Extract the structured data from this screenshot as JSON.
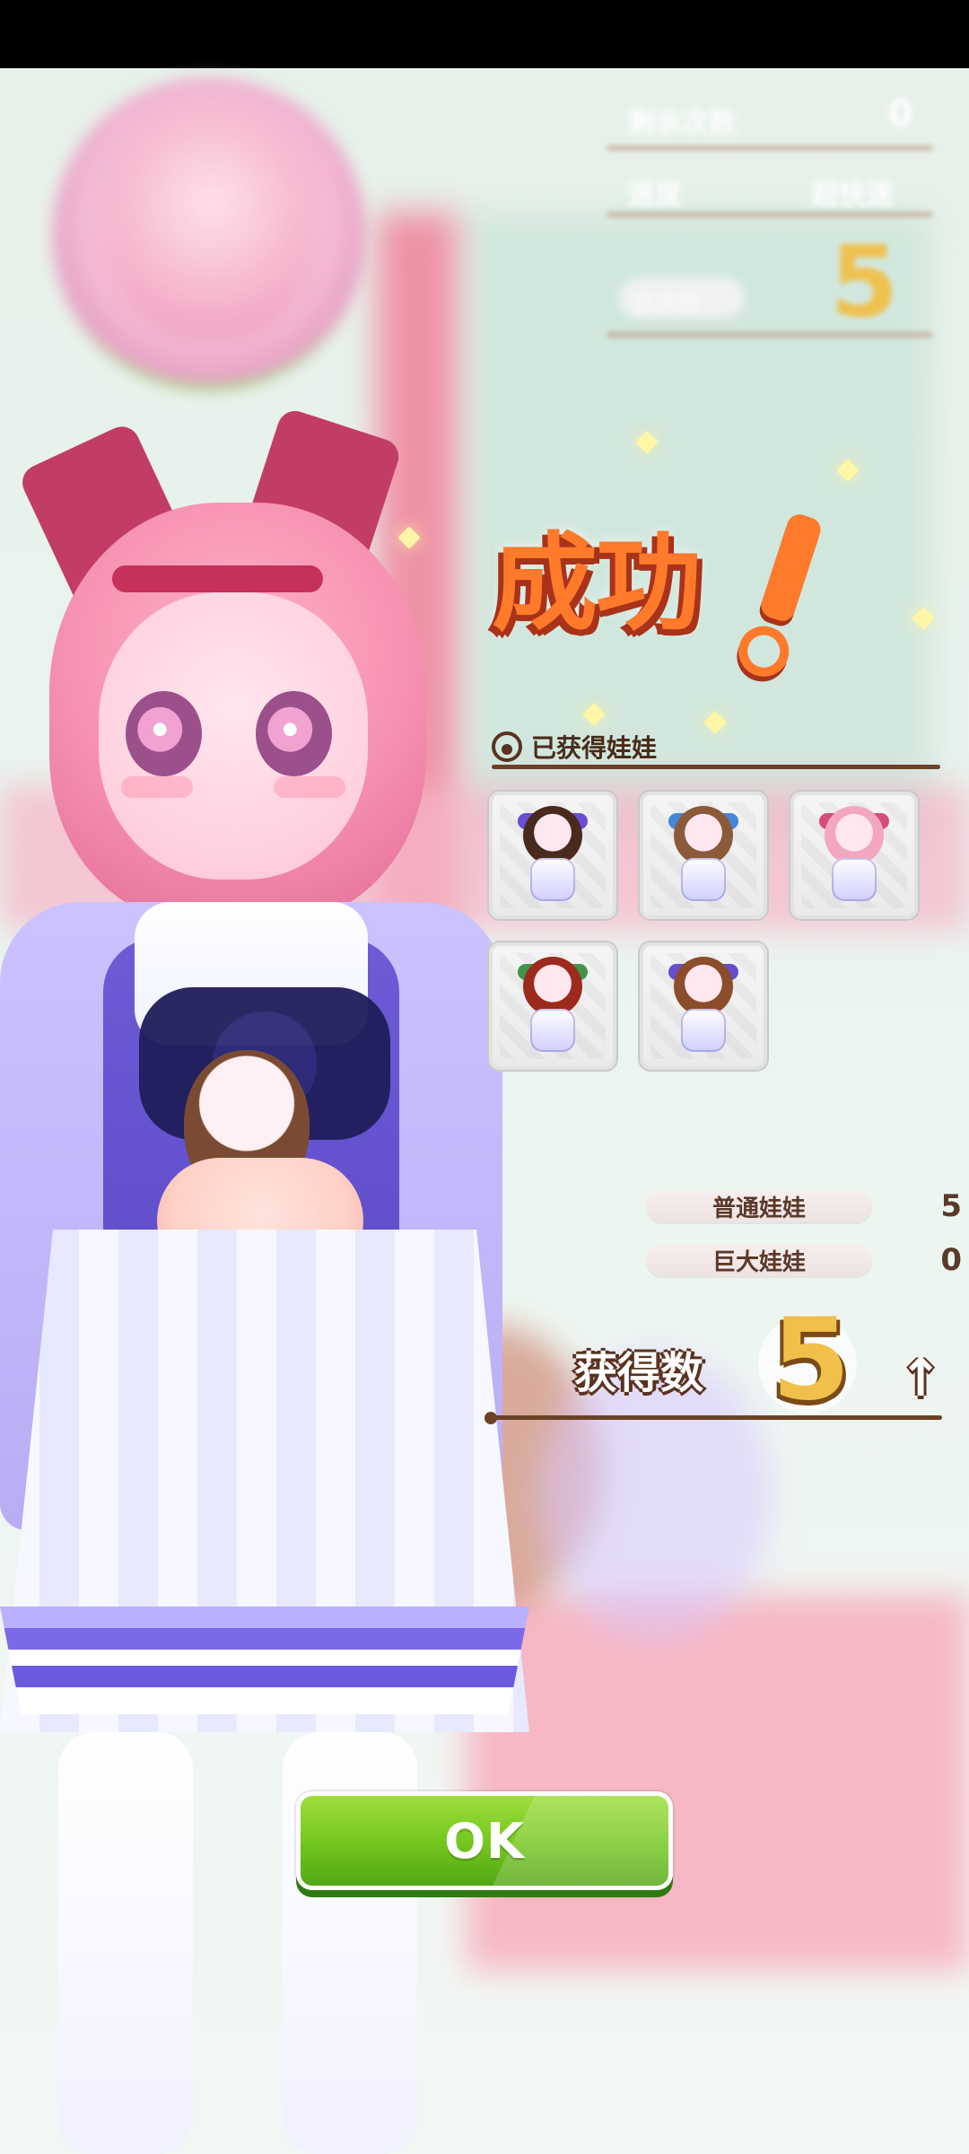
{
  "top_blur": {
    "row1_label": "剩余次数",
    "row1_value": "0",
    "row2_left": "速度",
    "row2_right": "超快速",
    "row3_label": "获得数",
    "row3_value": "5"
  },
  "result": {
    "success_text": "成功",
    "obtained_section_title": "已获得娃娃"
  },
  "dolls": [
    {
      "label": "doll-1",
      "hair": "#4a2a1e",
      "acc": "#5b3bd0"
    },
    {
      "label": "doll-2",
      "hair": "#8a5a3b",
      "acc": "#2f7bd8"
    },
    {
      "label": "doll-3",
      "hair": "#f3a6bf",
      "acc": "#d13c6b"
    },
    {
      "label": "doll-4",
      "hair": "#9c2a1d",
      "acc": "#2e8a3a"
    },
    {
      "label": "doll-5",
      "hair": "#8b4d2a",
      "acc": "#5a3bc9"
    }
  ],
  "counts": {
    "normal_label": "普通娃娃",
    "normal_value": "5",
    "giant_label": "巨大娃娃",
    "giant_value": "0"
  },
  "obtained": {
    "label": "获得数",
    "value": "5",
    "arrow": "↑"
  },
  "button": {
    "ok_label": "OK"
  },
  "colors": {
    "accent_orange": "#ff7a2b",
    "brown": "#6a4226",
    "ok_green": "#72c51e",
    "number_gold": "#f1c04a"
  }
}
